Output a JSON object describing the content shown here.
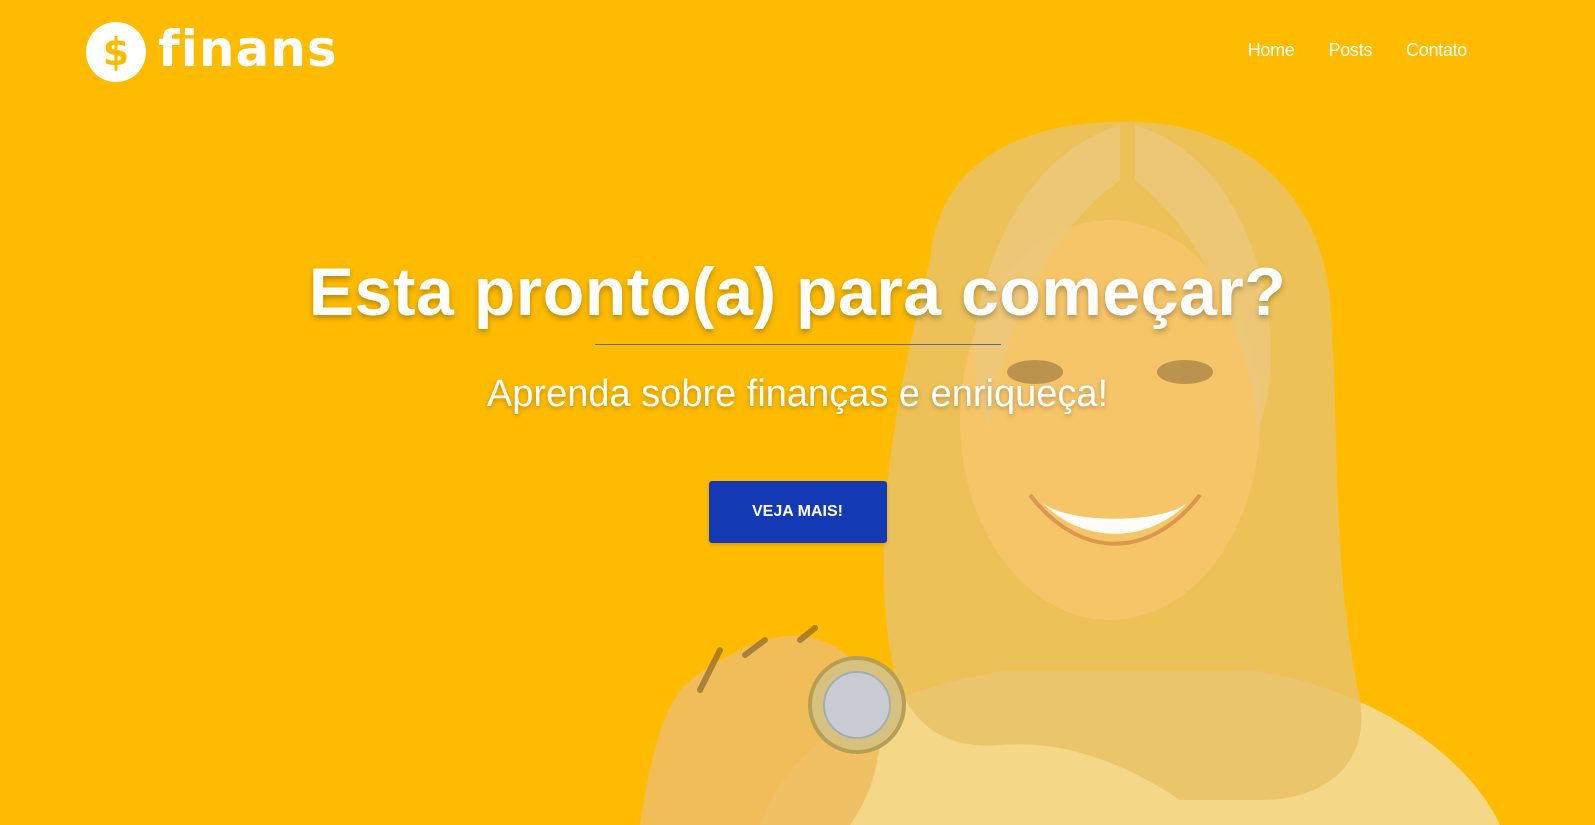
{
  "brand": {
    "logo_symbol": "$",
    "name": "finans"
  },
  "nav": {
    "items": [
      "Home",
      "Posts",
      "Contato"
    ]
  },
  "hero": {
    "title": "Esta pronto(a) para começar?",
    "subtitle": "Aprenda sobre finanças e enriqueça!",
    "cta_label": "VEJA MAIS!"
  },
  "colors": {
    "background": "#FFBB00",
    "cta": "#1339B5",
    "text": "#FFFFFF"
  }
}
